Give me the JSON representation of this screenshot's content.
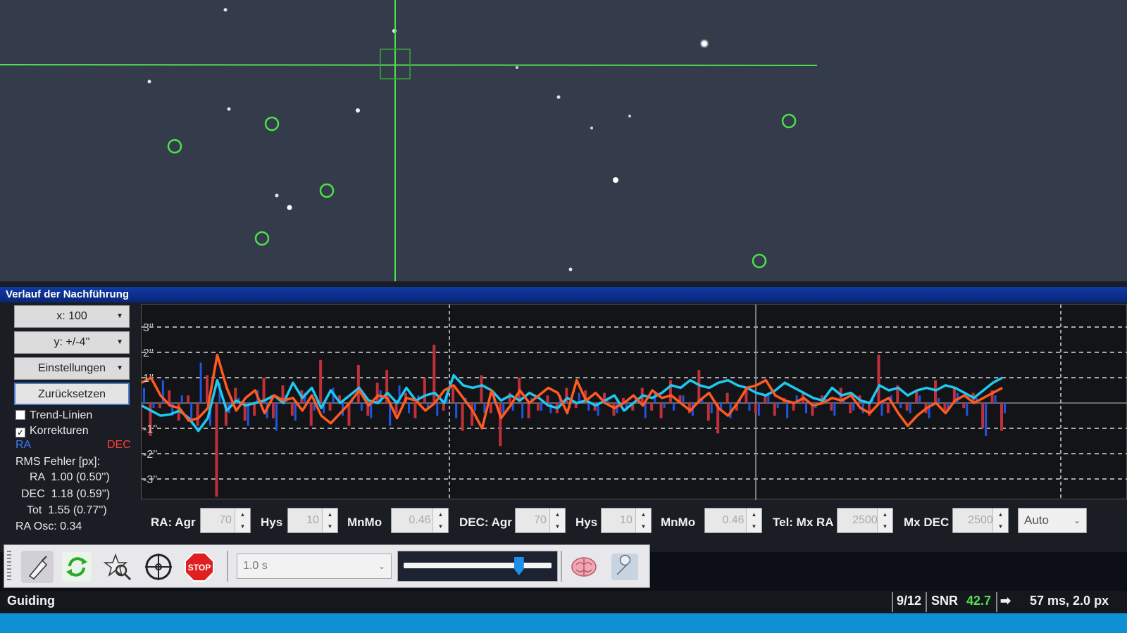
{
  "history_panel": {
    "title": "Verlauf der Nachführung",
    "x_scale": "x: 100",
    "y_scale": "y: +/-4''",
    "settings": "Einstellungen",
    "reset": "Zurücksetzen",
    "trend_lines": "Trend-Linien",
    "corrections": "Korrekturen",
    "legend_ra": "RA",
    "legend_dec": "DEC",
    "rms_header": "RMS Fehler [px]:",
    "rms_ra": "RA  1.00 (0.50'')",
    "rms_dec": "DEC  1.18 (0.59'')",
    "rms_tot": "Tot  1.55 (0.77'')",
    "ra_osc": "RA Osc: 0.34",
    "y_ticks": [
      "3''",
      "2''",
      "1''",
      "-1''",
      "-2''",
      "-3''"
    ]
  },
  "guide_params": {
    "ra_agr_label": "RA: Agr",
    "ra_agr": "70",
    "ra_hys_label": "Hys",
    "ra_hys": "10",
    "ra_mnmo_label": "MnMo",
    "ra_mnmo": "0.46",
    "dec_agr_label": "DEC: Agr",
    "dec_agr": "70",
    "dec_hys_label": "Hys",
    "dec_hys": "10",
    "dec_mnmo_label": "MnMo",
    "dec_mnmo": "0.46",
    "tel_mx_ra_label": "Tel: Mx RA",
    "tel_mx_ra": "2500",
    "mx_dec_label": "Mx DEC",
    "mx_dec": "2500",
    "mode": "Auto"
  },
  "toolbar": {
    "exposure": "1.0 s",
    "gamma_level": 0.78,
    "stop_label": "STOP"
  },
  "status": {
    "mode": "Guiding",
    "frame": "9/12",
    "snr_label": "SNR",
    "snr_value": "42.7",
    "correction": "57 ms, 2.0 px"
  },
  "colors": {
    "ra_line": "#1ec8f0",
    "dec_line": "#ff5a22",
    "ra_corr": "#1f55e0",
    "dec_corr": "#c0303a",
    "reticle": "#4ee04a",
    "snr": "#52e052"
  },
  "chart_data": {
    "type": "line",
    "title": "",
    "ylabel": "",
    "ylim": [
      -3.8,
      3.8
    ],
    "series": [
      {
        "name": "RA",
        "values": [
          -0.1,
          -0.3,
          -0.5,
          -0.45,
          -0.3,
          -0.6,
          -1.1,
          -0.6,
          0.9,
          -0.3,
          0.1,
          -0.1,
          0.0,
          0.1,
          0.3,
          0.0,
          0.8,
          0.2,
          0.6,
          -0.2,
          0.5,
          0.0,
          0.3,
          0.6,
          0.1,
          0.0,
          0.4,
          0.0,
          0.6,
          0.1,
          0.3,
          0.4,
          0.0,
          1.1,
          0.7,
          0.6,
          0.7,
          0.5,
          0.1,
          0.3,
          0.1,
          0.4,
          0.2,
          -0.1,
          -0.2,
          0.2,
          0.0,
          0.1,
          -0.1,
          0.1,
          0.3,
          -0.3,
          0.0,
          0.3,
          0.2,
          0.4,
          0.7,
          0.6,
          0.9,
          0.7,
          0.6,
          0.8,
          0.9,
          0.7,
          0.6,
          0.4,
          0.3,
          0.5,
          0.8,
          0.6,
          0.4,
          0.2,
          0.1,
          0.6,
          0.3,
          0.4,
          0.1,
          0.0,
          0.7,
          0.5,
          0.6,
          0.3,
          0.5,
          0.6,
          0.5,
          0.7,
          0.6,
          0.4,
          0.2,
          0.5,
          0.8,
          1.0
        ]
      },
      {
        "name": "DEC",
        "values": [
          0.8,
          1.0,
          0.3,
          -0.1,
          -0.2,
          -0.7,
          -0.6,
          -0.2,
          1.9,
          0.6,
          -0.3,
          0.2,
          0.5,
          -0.4,
          0.3,
          0.1,
          0.2,
          -0.3,
          0.3,
          -0.5,
          -0.8,
          -0.4,
          0.0,
          0.5,
          -0.1,
          0.3,
          0.2,
          -0.6,
          0.2,
          0.1,
          -0.3,
          0.0,
          0.5,
          0.7,
          0.2,
          -0.3,
          -1.0,
          0.5,
          -0.6,
          -0.1,
          0.5,
          0.0,
          0.3,
          0.6,
          0.4,
          -0.4,
          0.9,
          0.1,
          0.4,
          0.0,
          -0.2,
          0.0,
          0.3,
          -0.1,
          0.5,
          0.2,
          0.3,
          0.0,
          -0.3,
          0.1,
          0.4,
          -0.2,
          -0.5,
          0.0,
          0.6,
          0.7,
          0.9,
          0.3,
          0.1,
          0.0,
          0.2,
          -0.1,
          0.0,
          0.2,
          0.1,
          0.3,
          -0.2,
          -0.4,
          0.0,
          0.2,
          -0.4,
          -0.9,
          -0.5,
          -0.2,
          0.0,
          -0.4,
          0.1,
          0.3,
          0.0,
          0.2,
          0.4,
          0.6
        ]
      }
    ],
    "corrections": {
      "ra": [
        0.6,
        -0.2,
        0.9,
        -0.5,
        0.3,
        -0.8,
        1.6,
        -0.9,
        0.8,
        -0.4,
        0.2,
        -0.9,
        0.5,
        -0.6,
        -1.1,
        0.3,
        -0.7,
        0.4,
        -0.3,
        -0.4,
        0.6,
        -0.5,
        0.2,
        -0.3,
        -0.6,
        0.5,
        -0.9,
        0.7,
        -0.4,
        0.3,
        -0.2,
        -0.5,
        0.4,
        -0.6,
        0.2,
        -0.3,
        -0.4,
        0.3,
        -0.5,
        -0.3,
        -0.6,
        0.2,
        -0.3,
        -0.4,
        0.3,
        -0.2,
        0.4,
        -0.3,
        -0.5,
        0.2,
        -0.4,
        -0.3,
        0.2,
        -0.6,
        0.4,
        -0.2,
        -0.3,
        0.3,
        -0.5,
        0.2,
        -0.4,
        -0.3,
        -0.6,
        0.2,
        -0.3,
        -0.5,
        0.4,
        -0.2,
        -0.6,
        0.3,
        -0.4,
        -0.2,
        0.3,
        -0.5,
        0.2,
        -0.3,
        -0.4,
        0.2,
        -0.5,
        0.3,
        -0.2,
        -0.4,
        0.3,
        -0.6,
        0.2,
        -0.3,
        0.4,
        -0.5,
        0.2,
        -1.3,
        0.3,
        -0.4
      ],
      "dec": [
        -1.1,
        -1.3,
        -0.2,
        0.5,
        -0.7,
        0.3,
        -0.9,
        1.1,
        -3.7,
        -0.9,
        0.6,
        -0.7,
        -0.5,
        1.0,
        -0.6,
        0.7,
        -0.5,
        0.5,
        -0.9,
        1.7,
        -0.3,
        0.3,
        -0.9,
        1.5,
        -0.5,
        0.8,
        1.3,
        -0.4,
        0.4,
        -0.6,
        1.0,
        2.3,
        -0.3,
        0.6,
        -1.1,
        -0.9,
        1.1,
        -0.4,
        -1.7,
        0.4,
        1.0,
        -0.6,
        -0.3,
        0.3,
        -0.4,
        0.6,
        -0.2,
        0.5,
        -0.3,
        0.4,
        -0.5,
        0.2,
        -0.3,
        0.6,
        -0.3,
        -0.6,
        0.9,
        0.3,
        -0.4,
        1.3,
        -0.7,
        -1.2,
        0.4,
        -0.3,
        0.5,
        -0.4,
        0.3,
        -0.5,
        0.2,
        -0.3,
        0.4,
        -0.5,
        0.3,
        -0.3,
        0.6,
        -0.4,
        0.3,
        -0.5,
        1.9,
        -0.4,
        0.7,
        -0.3,
        0.5,
        -0.4,
        0.9,
        -0.3,
        0.6,
        -0.2,
        0.4,
        -1.0,
        0.5,
        -1.1
      ]
    }
  }
}
